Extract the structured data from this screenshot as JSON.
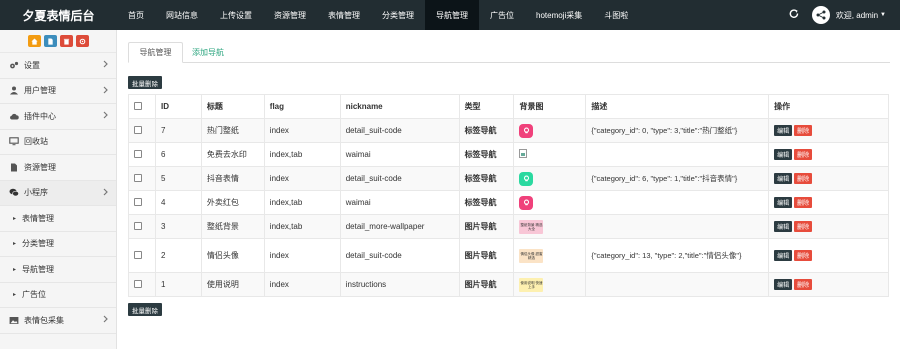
{
  "brand": {
    "title": "夕夏表情后台"
  },
  "topnav": {
    "items": [
      {
        "label": "首页",
        "name": "nav-home"
      },
      {
        "label": "网站信息",
        "name": "nav-site-info"
      },
      {
        "label": "上传设置",
        "name": "nav-upload-settings"
      },
      {
        "label": "资源管理",
        "name": "nav-resources"
      },
      {
        "label": "表情管理",
        "name": "nav-emoji"
      },
      {
        "label": "分类管理",
        "name": "nav-category"
      },
      {
        "label": "导航管理",
        "name": "nav-navigation",
        "active": true
      },
      {
        "label": "广告位",
        "name": "nav-ads"
      },
      {
        "label": "hotemoji采集",
        "name": "nav-hotemoji"
      },
      {
        "label": "斗图啦",
        "name": "nav-doutula"
      }
    ],
    "user_label": "欢迎, admin"
  },
  "sidebar": {
    "quick_buttons": [
      {
        "icon": "home-icon",
        "color": "#f39c12"
      },
      {
        "icon": "document-icon",
        "color": "#3c8dbc"
      },
      {
        "icon": "trash-icon",
        "color": "#dd4b39"
      },
      {
        "icon": "refresh-icon",
        "color": "#dd4b39"
      }
    ],
    "items": [
      {
        "label": "设置",
        "icon": "gears-icon",
        "arrow": true
      },
      {
        "label": "用户管理",
        "icon": "users-icon",
        "arrow": true
      },
      {
        "label": "插件中心",
        "icon": "cloud-icon",
        "arrow": true
      },
      {
        "label": "回收站",
        "icon": "monitor-icon",
        "arrow": false
      },
      {
        "label": "资源管理",
        "icon": "file-icon",
        "arrow": false
      },
      {
        "label": "小程序",
        "icon": "wechat-icon",
        "arrow": true,
        "open": true
      },
      {
        "label": "表情管理",
        "sub": true
      },
      {
        "label": "分类管理",
        "sub": true
      },
      {
        "label": "导航管理",
        "sub": true
      },
      {
        "label": "广告位",
        "sub": true
      },
      {
        "label": "表情包采集",
        "icon": "image-icon",
        "arrow": true
      }
    ]
  },
  "tabs": {
    "active": "导航管理",
    "add": "添加导航"
  },
  "batch_delete_label": "批量删除",
  "table": {
    "headers": [
      "ID",
      "标题",
      "flag",
      "nickname",
      "类型",
      "背景图",
      "描述",
      "操作"
    ],
    "edit_label": "编辑",
    "delete_label": "删除",
    "rows": [
      {
        "id": "7",
        "title": "热门整纸",
        "flag": "index",
        "nickname": "detail_suit-code",
        "type": "标签导航",
        "bg": {
          "kind": "icon",
          "color": "#f0417b",
          "icon": "pink-sticker-icon"
        },
        "desc": "{\"category_id\": 0, \"type\": 3,\"title\":\"热门整纸\"}"
      },
      {
        "id": "6",
        "title": "免费去水印",
        "flag": "index,tab",
        "nickname": "waimai",
        "type": "标签导航",
        "bg": {
          "kind": "broken",
          "icon": "broken-image-icon"
        },
        "desc": ""
      },
      {
        "id": "5",
        "title": "抖音表情",
        "flag": "index",
        "nickname": "detail_suit-code",
        "type": "标签导航",
        "bg": {
          "kind": "icon",
          "color": "#2bd9a0",
          "icon": "green-face-icon"
        },
        "desc": "{\"category_id\": 6, \"type\": 1,\"title\":\"抖音表情\"}"
      },
      {
        "id": "4",
        "title": "外卖红包",
        "flag": "index,tab",
        "nickname": "waimai",
        "type": "标签导航",
        "bg": {
          "kind": "icon",
          "color": "#f0417b",
          "icon": "red-envelope-icon"
        },
        "desc": ""
      },
      {
        "id": "3",
        "title": "整纸背景",
        "flag": "index,tab",
        "nickname": "detail_more-wallpaper",
        "type": "图片导航",
        "bg": {
          "kind": "banner",
          "color": "#f8c6d6",
          "text": "整纸背景 精选大全",
          "icon": "wallpaper-banner-icon"
        },
        "desc": ""
      },
      {
        "id": "2",
        "title": "情侣头像",
        "flag": "index",
        "nickname": "detail_suit-code",
        "type": "图片导航",
        "bg": {
          "kind": "banner",
          "color": "#fbe3c6",
          "text": "情侣头像 甜蜜精选",
          "icon": "couple-avatar-banner-icon"
        },
        "desc": "{\"category_id\": 13, \"type\": 2,\"title\":\"情侣头像\"}",
        "tall": true
      },
      {
        "id": "1",
        "title": "使用说明",
        "flag": "index",
        "nickname": "instructions",
        "type": "图片导航",
        "bg": {
          "kind": "banner",
          "color": "#fdf0b0",
          "text": "使用说明 快速上手",
          "icon": "instructions-banner-icon"
        },
        "desc": ""
      }
    ]
  }
}
